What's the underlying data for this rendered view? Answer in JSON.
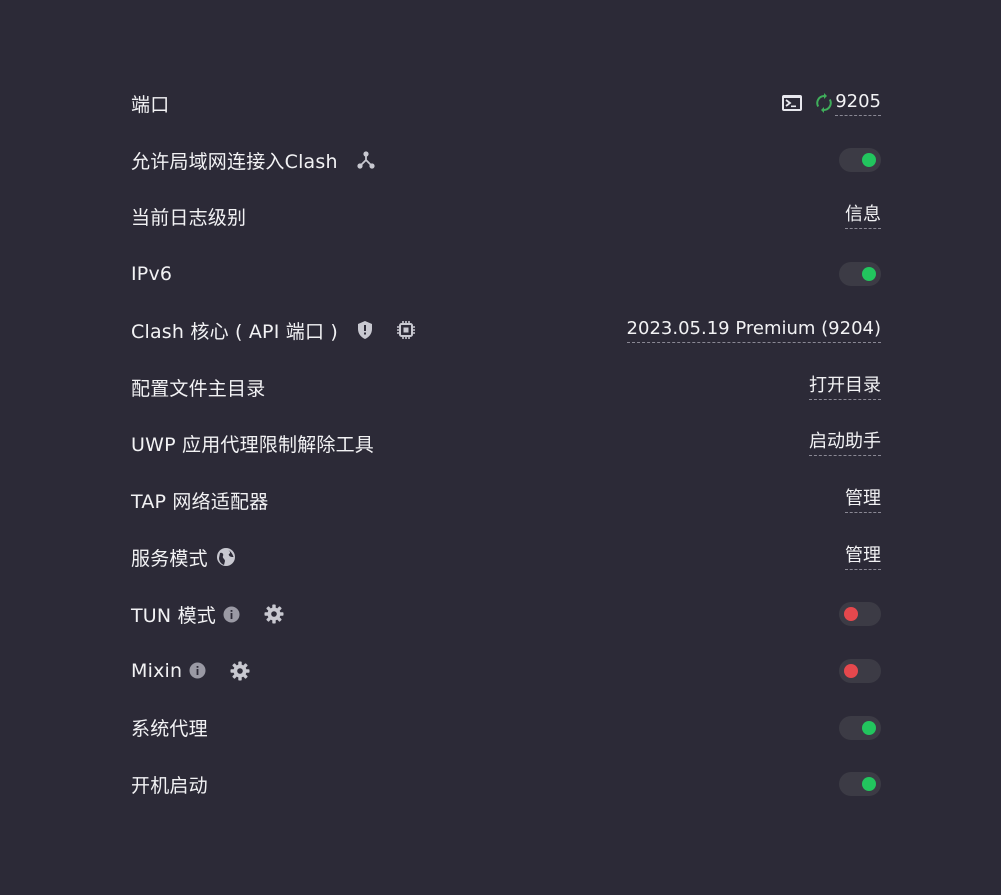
{
  "settings": {
    "port": {
      "label": "端口",
      "value": "9205"
    },
    "lan": {
      "label": "允许局域网连接入Clash",
      "toggle": true
    },
    "log_level": {
      "label": "当前日志级别",
      "value": "信息"
    },
    "ipv6": {
      "label": "IPv6",
      "toggle": true
    },
    "core": {
      "label": "Clash 核心 ( API 端口 )",
      "value": "2023.05.19 Premium (9204)"
    },
    "config_dir": {
      "label": "配置文件主目录",
      "value": "打开目录"
    },
    "uwp": {
      "label": "UWP 应用代理限制解除工具",
      "value": "启动助手"
    },
    "tap": {
      "label": "TAP 网络适配器",
      "value": "管理"
    },
    "service": {
      "label": "服务模式",
      "value": "管理"
    },
    "tun": {
      "label": "TUN 模式",
      "toggle": false
    },
    "mixin": {
      "label": "Mixin",
      "toggle": false
    },
    "system_proxy": {
      "label": "系统代理",
      "toggle": true
    },
    "autostart": {
      "label": "开机启动",
      "toggle": true
    }
  },
  "colors": {
    "background": "#2c2a37",
    "toggle_on": "#22c55e",
    "toggle_off": "#e5484d",
    "refresh_icon": "#3fae5b"
  },
  "icons": {
    "terminal": "terminal-icon",
    "refresh": "refresh-icon",
    "network": "network-icon",
    "shield": "shield-icon",
    "chip": "chip-icon",
    "globe": "globe-icon",
    "info": "info-icon",
    "gear": "gear-icon"
  }
}
